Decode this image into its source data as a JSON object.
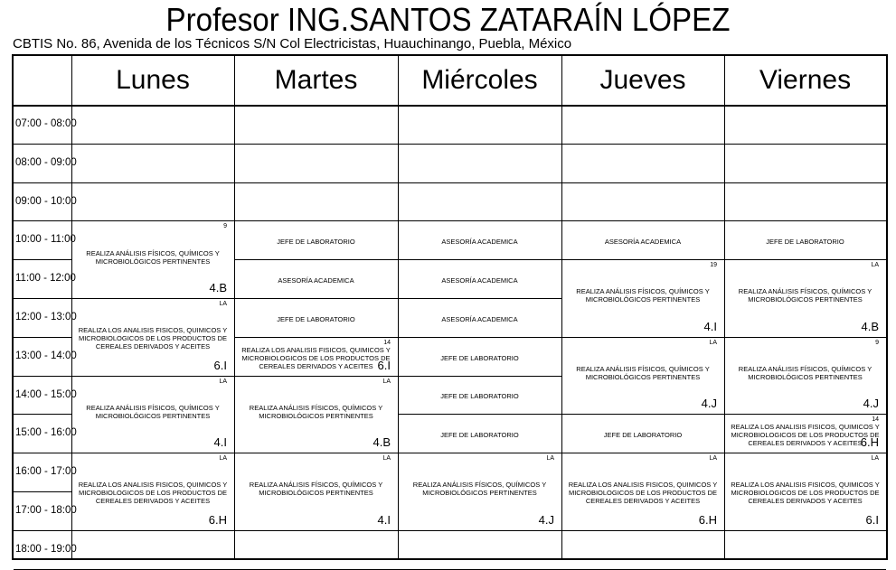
{
  "header": {
    "title": "Profesor ING.SANTOS ZATARAÍN LÓPEZ",
    "subtitle": "CBTIS No. 86, Avenida de los Técnicos S/N Col Electricistas, Huauchinango, Puebla, México"
  },
  "days": [
    "Lunes",
    "Martes",
    "Miércoles",
    "Jueves",
    "Viernes"
  ],
  "times": [
    "07:00 - 08:00",
    "08:00 - 09:00",
    "09:00 - 10:00",
    "10:00 - 11:00",
    "11:00 - 12:00",
    "12:00 - 13:00",
    "13:00 - 14:00",
    "14:00 - 15:00",
    "15:00 - 16:00",
    "16:00 - 17:00",
    "17:00 - 18:00",
    "18:00 - 19:00"
  ],
  "blocks": [
    {
      "day": 0,
      "start": 3,
      "span": 2,
      "text": "REALIZA ANÁLISIS FÍSICOS, QUÍMICOS Y MICROBIOLÓGICOS PERTINENTES",
      "corner": "9",
      "group": "4.B"
    },
    {
      "day": 0,
      "start": 5,
      "span": 2,
      "text": "REALIZA LOS ANALISIS FISICOS, QUIMICOS Y MICROBIOLOGICOS DE LOS PRODUCTOS DE CEREALES DERIVADOS Y ACEITES",
      "corner": "LA",
      "group": "6.I"
    },
    {
      "day": 0,
      "start": 7,
      "span": 2,
      "text": "REALIZA ANÁLISIS FÍSICOS, QUÍMICOS Y MICROBIOLÓGICOS PERTINENTES",
      "corner": "LA",
      "group": "4.I"
    },
    {
      "day": 0,
      "start": 9,
      "span": 2,
      "text": "REALIZA LOS ANALISIS FISICOS, QUIMICOS Y MICROBIOLOGICOS DE LOS PRODUCTOS DE CEREALES DERIVADOS Y ACEITES",
      "corner": "LA",
      "group": "6.H"
    },
    {
      "day": 1,
      "start": 3,
      "span": 1,
      "text": "JEFE DE LABORATORIO",
      "corner": "",
      "group": ""
    },
    {
      "day": 1,
      "start": 4,
      "span": 1,
      "text": "ASESORÍA ACADEMICA",
      "corner": "",
      "group": ""
    },
    {
      "day": 1,
      "start": 5,
      "span": 1,
      "text": "JEFE DE LABORATORIO",
      "corner": "",
      "group": ""
    },
    {
      "day": 1,
      "start": 6,
      "span": 1,
      "text": "REALIZA LOS ANALISIS FISICOS, QUIMICOS Y MICROBIOLOGICOS DE LOS PRODUCTOS DE CEREALES DERIVADOS Y ACEITES",
      "corner": "14",
      "group": "6.I"
    },
    {
      "day": 1,
      "start": 7,
      "span": 2,
      "text": "REALIZA ANÁLISIS FÍSICOS, QUÍMICOS Y MICROBIOLÓGICOS PERTINENTES",
      "corner": "LA",
      "group": "4.B"
    },
    {
      "day": 1,
      "start": 9,
      "span": 2,
      "text": "REALIZA ANÁLISIS FÍSICOS, QUÍMICOS Y MICROBIOLÓGICOS PERTINENTES",
      "corner": "LA",
      "group": "4.I"
    },
    {
      "day": 2,
      "start": 3,
      "span": 1,
      "text": "ASESORÍA ACADEMICA",
      "corner": "",
      "group": ""
    },
    {
      "day": 2,
      "start": 4,
      "span": 1,
      "text": "ASESORÍA ACADEMICA",
      "corner": "",
      "group": ""
    },
    {
      "day": 2,
      "start": 5,
      "span": 1,
      "text": "ASESORÍA ACADEMICA",
      "corner": "",
      "group": ""
    },
    {
      "day": 2,
      "start": 6,
      "span": 1,
      "text": "JEFE DE LABORATORIO",
      "corner": "",
      "group": ""
    },
    {
      "day": 2,
      "start": 7,
      "span": 1,
      "text": "JEFE DE LABORATORIO",
      "corner": "",
      "group": ""
    },
    {
      "day": 2,
      "start": 8,
      "span": 1,
      "text": "JEFE DE LABORATORIO",
      "corner": "",
      "group": ""
    },
    {
      "day": 2,
      "start": 9,
      "span": 2,
      "text": "REALIZA ANÁLISIS FÍSICOS, QUÍMICOS Y MICROBIOLÓGICOS PERTINENTES",
      "corner": "LA",
      "group": "4.J"
    },
    {
      "day": 3,
      "start": 3,
      "span": 1,
      "text": "ASESORÍA ACADEMICA",
      "corner": "",
      "group": ""
    },
    {
      "day": 3,
      "start": 4,
      "span": 2,
      "text": "REALIZA ANÁLISIS FÍSICOS, QUÍMICOS Y MICROBIOLÓGICOS PERTINENTES",
      "corner": "19",
      "group": "4.I"
    },
    {
      "day": 3,
      "start": 6,
      "span": 2,
      "text": "REALIZA ANÁLISIS FÍSICOS, QUÍMICOS Y MICROBIOLÓGICOS PERTINENTES",
      "corner": "LA",
      "group": "4.J"
    },
    {
      "day": 3,
      "start": 8,
      "span": 1,
      "text": "JEFE DE LABORATORIO",
      "corner": "",
      "group": ""
    },
    {
      "day": 3,
      "start": 9,
      "span": 2,
      "text": "REALIZA LOS ANALISIS FISICOS, QUIMICOS Y MICROBIOLOGICOS DE LOS PRODUCTOS DE CEREALES DERIVADOS Y ACEITES",
      "corner": "LA",
      "group": "6.H"
    },
    {
      "day": 4,
      "start": 3,
      "span": 1,
      "text": "JEFE DE LABORATORIO",
      "corner": "",
      "group": ""
    },
    {
      "day": 4,
      "start": 4,
      "span": 2,
      "text": "REALIZA ANÁLISIS FÍSICOS, QUÍMICOS Y MICROBIOLÓGICOS PERTINENTES",
      "corner": "LA",
      "group": "4.B"
    },
    {
      "day": 4,
      "start": 6,
      "span": 2,
      "text": "REALIZA ANÁLISIS FÍSICOS, QUÍMICOS Y MICROBIOLÓGICOS PERTINENTES",
      "corner": "9",
      "group": "4.J"
    },
    {
      "day": 4,
      "start": 8,
      "span": 1,
      "text": "REALIZA LOS ANALISIS FISICOS, QUIMICOS Y MICROBIOLOGICOS DE LOS PRODUCTOS DE CEREALES DERIVADOS Y ACEITES",
      "corner": "14",
      "group": "6.H"
    },
    {
      "day": 4,
      "start": 9,
      "span": 2,
      "text": "REALIZA LOS ANALISIS FISICOS, QUIMICOS Y MICROBIOLOGICOS DE LOS PRODUCTOS DE CEREALES DERIVADOS Y ACEITES",
      "corner": "LA",
      "group": "6.I"
    }
  ]
}
